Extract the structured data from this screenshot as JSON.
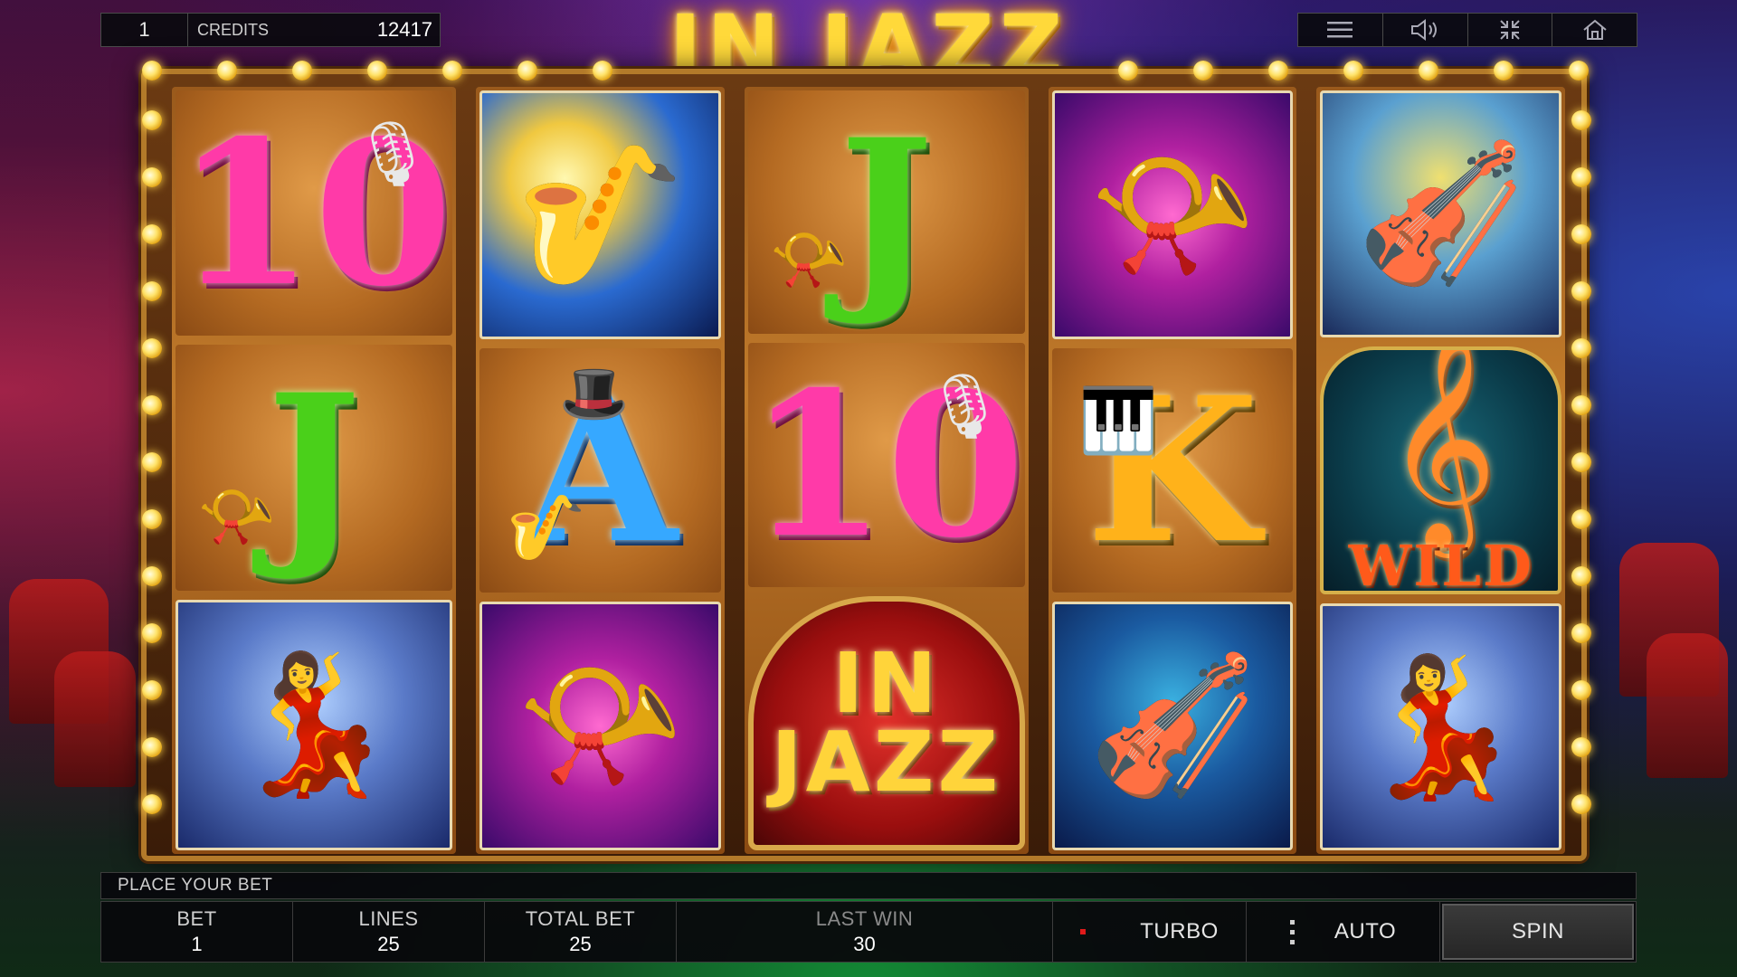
{
  "game": {
    "title": "IN JAZZ"
  },
  "topbar": {
    "bet_per_line": "1",
    "credits_label": "CREDITS",
    "credits_value": "12417",
    "buttons": [
      {
        "name": "menu",
        "icon": "menu-icon"
      },
      {
        "name": "sound",
        "icon": "speaker-icon"
      },
      {
        "name": "fullscreen",
        "icon": "collapse-icon"
      },
      {
        "name": "home",
        "icon": "home-icon"
      }
    ]
  },
  "reels": [
    [
      "ten-microphone",
      "sax-player",
      "jack-horn"
    ],
    [
      "jack-horn",
      "ace-saxophone",
      "tuba"
    ],
    [
      "jack-horn",
      "ten-microphone",
      "in-jazz-logo"
    ],
    [
      "tuba",
      "king-piano",
      "double-bass"
    ],
    [
      "bass-player",
      "wild-clef",
      "singer"
    ]
  ],
  "symbols": {
    "ten": "10",
    "jack": "J",
    "ace": "A",
    "king": "K",
    "wild_text": "WILD",
    "logo_line1": "IN",
    "logo_line2": "JAZZ"
  },
  "status": {
    "message": "PLACE YOUR BET"
  },
  "controls": {
    "bet_label": "BET",
    "bet_value": "1",
    "lines_label": "LINES",
    "lines_value": "25",
    "total_bet_label": "TOTAL BET",
    "total_bet_value": "25",
    "last_win_label": "LAST WIN",
    "last_win_value": "30",
    "turbo_label": "TURBO",
    "auto_label": "AUTO",
    "spin_label": "SPIN"
  },
  "colors": {
    "title_gold": "#ffd93a",
    "turbo_indicator": "#e01a1a",
    "frame_gold": "#b37a2a"
  }
}
